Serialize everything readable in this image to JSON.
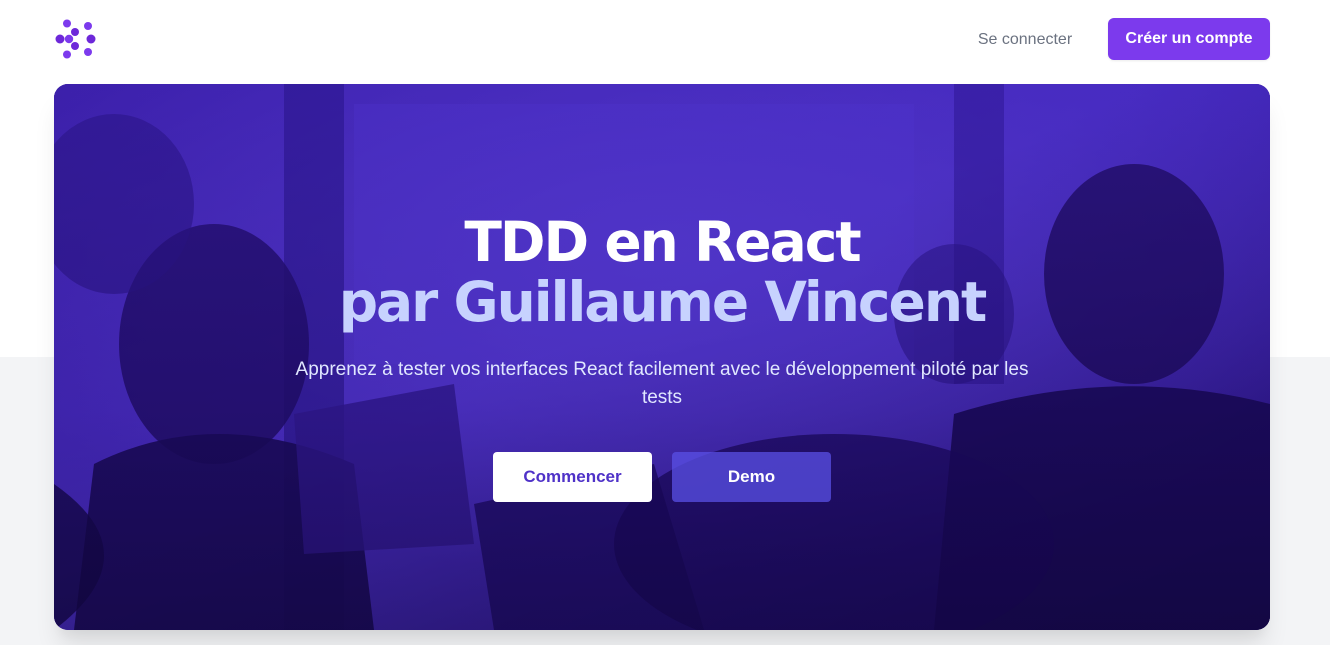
{
  "header": {
    "logo_icon": "dots-arrow-logo-icon",
    "signin_label": "Se connecter",
    "signup_label": "Créer un compte"
  },
  "hero": {
    "title_line1": "TDD en React",
    "title_line2": "par Guillaume Vincent",
    "subtitle": "Apprenez à tester vos interfaces React facilement avec le développement piloté par les tests",
    "start_label": "Commencer",
    "demo_label": "Demo",
    "background_icon": "people-working-on-laptops-photo"
  },
  "colors": {
    "accent": "#7c3aed",
    "hero_bg": "#2a1380",
    "title_secondary": "#c7d2fe",
    "start_text": "#4f32c8"
  }
}
